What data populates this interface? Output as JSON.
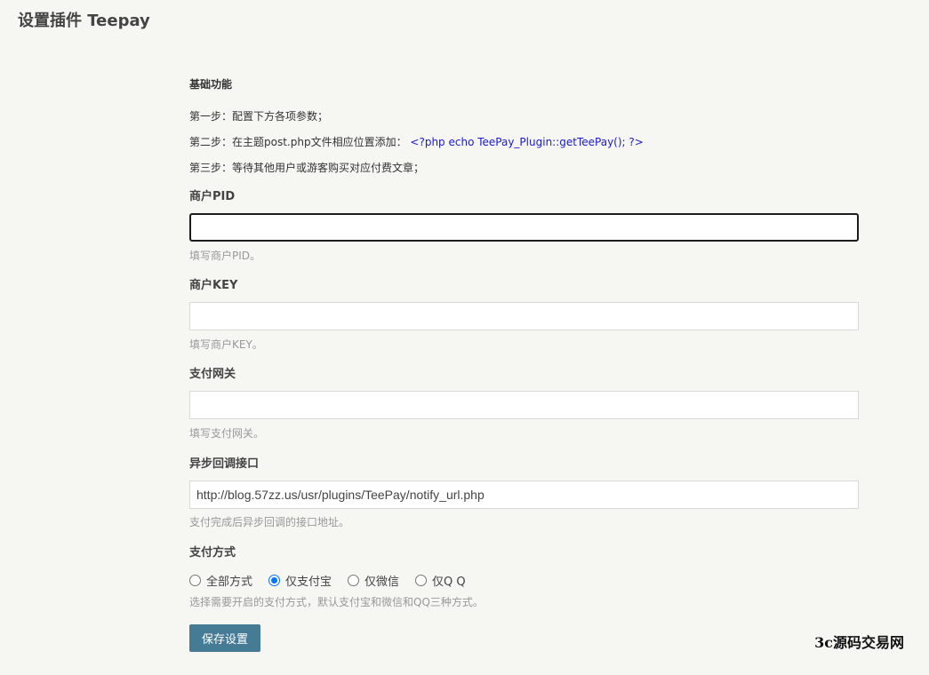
{
  "page": {
    "title": "设置插件 Teepay"
  },
  "basic": {
    "section_title": "基础功能",
    "step1": "第一步：配置下方各项参数；",
    "step2_prefix": "第二步：在主题post.php文件相应位置添加：",
    "step2_code": "<?php echo TeePay_Plugin::getTeePay(); ?>",
    "step3": "第三步：等待其他用户或游客购买对应付费文章；"
  },
  "fields": {
    "pid": {
      "label": "商户PID",
      "value": "",
      "hint": "填写商户PID。"
    },
    "key": {
      "label": "商户KEY",
      "value": "",
      "hint": "填写商户KEY。"
    },
    "gateway": {
      "label": "支付网关",
      "value": "",
      "hint": "填写支付网关。"
    },
    "notify": {
      "label": "异步回调接口",
      "value": "http://blog.57zz.us/usr/plugins/TeePay/notify_url.php",
      "hint": "支付完成后异步回调的接口地址。"
    }
  },
  "payment": {
    "label": "支付方式",
    "options": [
      {
        "label": "全部方式",
        "checked": false
      },
      {
        "label": "仅支付宝",
        "checked": true
      },
      {
        "label": "仅微信",
        "checked": false
      },
      {
        "label": "仅Q Q",
        "checked": false
      }
    ],
    "selected": "仅支付宝",
    "hint": "选择需要开启的支付方式，默认支付宝和微信和QQ三种方式。"
  },
  "actions": {
    "save_label": "保存设置"
  },
  "watermark": "3c源码交易网",
  "colors": {
    "background": "#f6f6f3",
    "button": "#467b96",
    "code": "#1a1ad6",
    "radio_checked": "#0075ff",
    "hint": "#999999"
  }
}
